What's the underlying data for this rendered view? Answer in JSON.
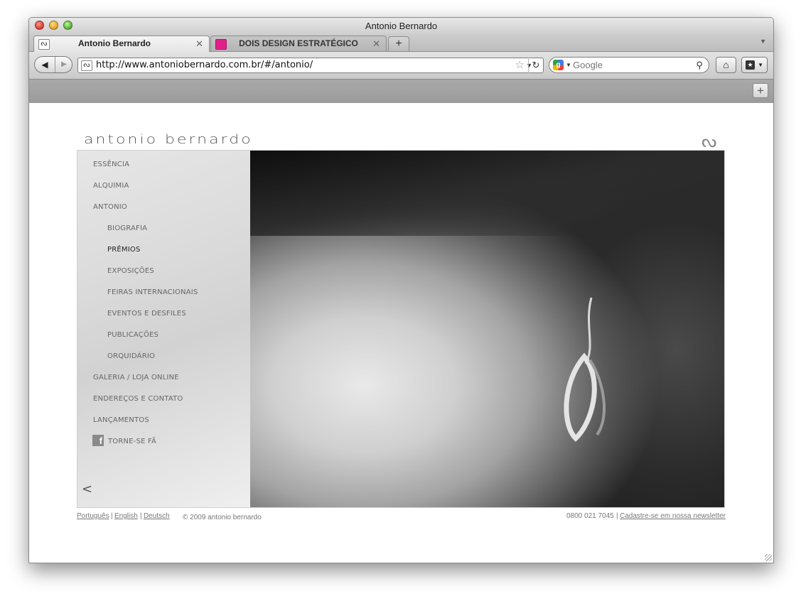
{
  "window": {
    "title": "Antonio Bernardo"
  },
  "tabs": [
    {
      "label": "Antonio Bernardo",
      "favicon": "logo-favicon-icon",
      "active": true
    },
    {
      "label": "DOIS DESIGN ESTRATÉGICO",
      "favicon": "pink-square-favicon-icon",
      "active": false
    }
  ],
  "toolbar": {
    "url": "http://www.antoniobernardo.com.br/#/antonio/",
    "search_placeholder": "Google"
  },
  "site": {
    "logo_text": "antonio bernardo",
    "menu": [
      {
        "label": "ESSÊNCIA",
        "level": 0,
        "active": false
      },
      {
        "label": "ALQUIMIA",
        "level": 0,
        "active": false
      },
      {
        "label": "ANTONIO",
        "level": 0,
        "active": false
      },
      {
        "label": "BIOGRAFIA",
        "level": 1,
        "active": false
      },
      {
        "label": "PRÊMIOS",
        "level": 1,
        "active": true
      },
      {
        "label": "EXPOSIÇÕES",
        "level": 1,
        "active": false
      },
      {
        "label": "FEIRAS INTERNACIONAIS",
        "level": 1,
        "active": false
      },
      {
        "label": "EVENTOS E DESFILES",
        "level": 1,
        "active": false
      },
      {
        "label": "PUBLICAÇÕES",
        "level": 1,
        "active": false
      },
      {
        "label": "ORQUIDÁRIO",
        "level": 1,
        "active": false
      },
      {
        "label": "GALERIA / LOJA ONLINE",
        "level": 0,
        "active": false
      },
      {
        "label": "ENDEREÇOS E CONTATO",
        "level": 0,
        "active": false
      },
      {
        "label": "LANÇAMENTOS",
        "level": 0,
        "active": false
      }
    ],
    "fan_label": "TORNE-SE FÃ",
    "collapse_label": "<",
    "footer": {
      "lang_pt": "Português",
      "lang_en": "English",
      "lang_de": "Deutsch",
      "separator": "|",
      "copyright": "© 2009 antonio bernardo",
      "phone": "0800 021 7045",
      "newsletter": "Cadastre-se em nossa newsletter"
    }
  }
}
